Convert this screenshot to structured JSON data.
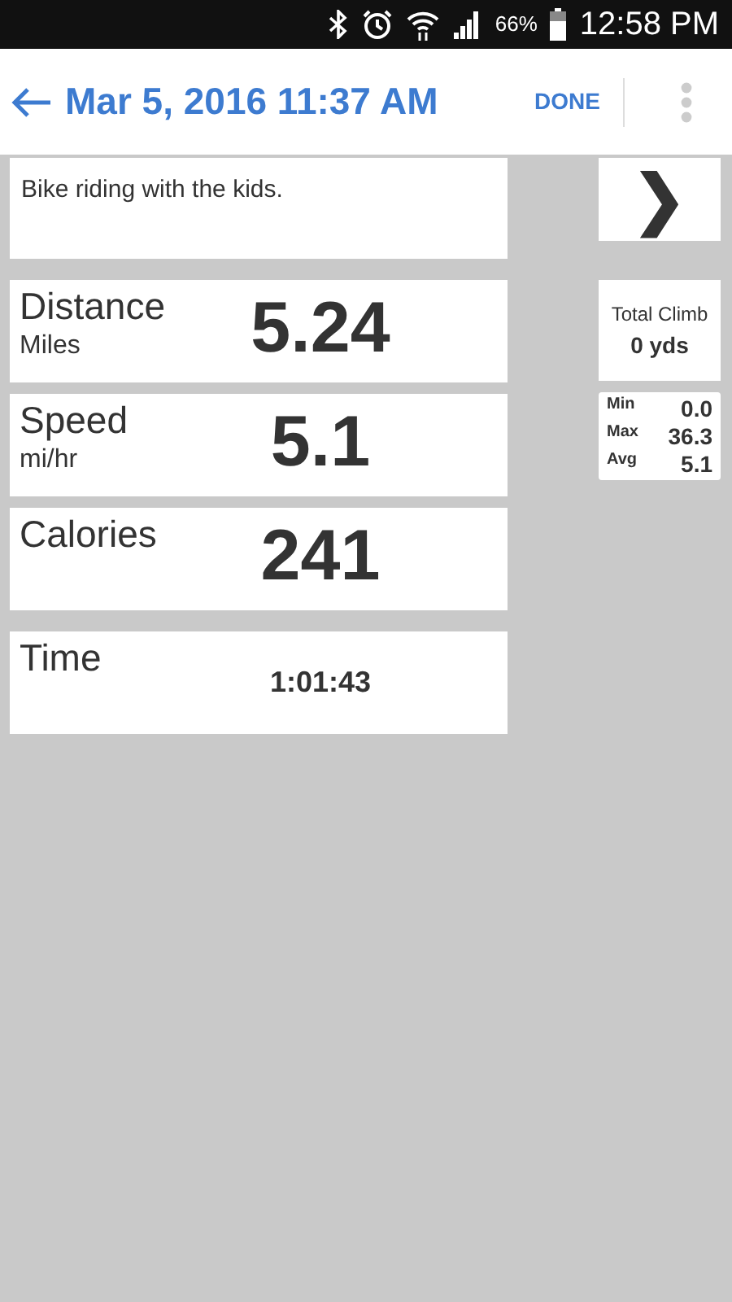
{
  "status_bar": {
    "battery": "66%",
    "time": "12:58 PM"
  },
  "app_bar": {
    "title": "Mar 5, 2016 11:37 AM",
    "action": "DONE"
  },
  "note": "Bike riding with the kids.",
  "next_button": "❯",
  "stats": [
    {
      "kind": "big",
      "label": "Distance",
      "unit": "Miles",
      "value": "5.24"
    },
    {
      "kind": "big",
      "label": "Speed",
      "unit": "mi/hr",
      "value": "5.1"
    },
    {
      "kind": "big",
      "label": "Calories",
      "value": "241"
    },
    {
      "kind": "small",
      "label": "Time",
      "value": "1:01:43"
    }
  ],
  "climb": {
    "label": "Total Climb",
    "value": "0 yds"
  },
  "speed_range": [
    {
      "label": "Min",
      "value": "0.0"
    },
    {
      "label": "Max",
      "value": "36.3"
    },
    {
      "label": "Avg",
      "value": "5.1"
    }
  ]
}
